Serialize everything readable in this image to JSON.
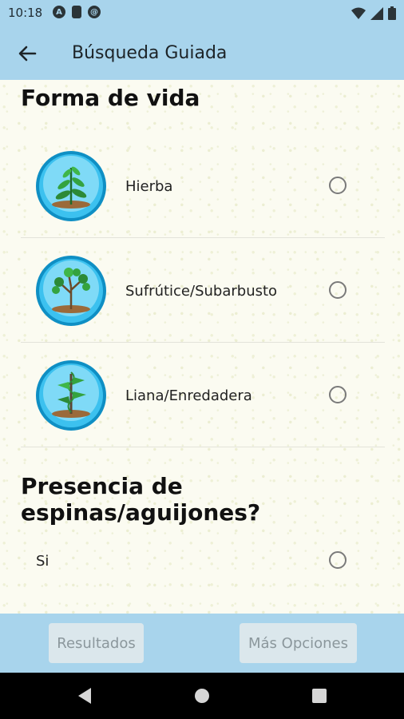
{
  "status_bar": {
    "time": "10:18",
    "icons": [
      "a-icon",
      "sd-card-icon",
      "at-icon"
    ],
    "right_icons": [
      "wifi-icon",
      "signal-icon",
      "battery-icon"
    ]
  },
  "app_bar": {
    "back_icon": "arrow-left-icon",
    "title": "Búsqueda Guiada"
  },
  "sections": [
    {
      "title": "Forma de vida",
      "options": [
        {
          "label": "Hierba",
          "icon": "herb-plant-icon",
          "selected": false
        },
        {
          "label": "Sufrútice/Subarbusto",
          "icon": "subshrub-plant-icon",
          "selected": false
        },
        {
          "label": "Liana/Enredadera",
          "icon": "vine-plant-icon",
          "selected": false
        }
      ]
    },
    {
      "title": "Presencia de espinas/aguijones?",
      "options": [
        {
          "label": "Si",
          "selected": false
        }
      ]
    }
  ],
  "bottom_bar": {
    "results_label": "Resultados",
    "more_options_label": "Más Opciones"
  },
  "colors": {
    "accent": "#a8d4ec",
    "button_disabled_bg": "#dbe7ec",
    "button_disabled_text": "#8b979c",
    "icon_ring": "#1aa6dc"
  }
}
